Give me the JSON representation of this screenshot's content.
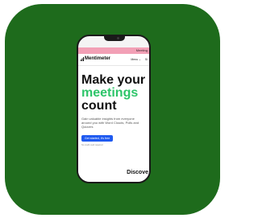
{
  "colors": {
    "tile_background": "#1e6b1c",
    "phone_frame": "#1a1a1a",
    "banner": "#f2a0b6",
    "headline_accent": "#2ec56a",
    "cta_button": "#1f5af0"
  },
  "banner": {
    "text": "Meeting"
  },
  "nav": {
    "logo": "Mentimeter",
    "link_1": "Menu ⌄",
    "link_2": "Si"
  },
  "hero": {
    "line_1": "Make your",
    "line_2": "meetings",
    "line_3": "count",
    "body": "Gain valuable insights from everyone around you with Word Clouds, Polls and Quizzes",
    "cta_label": "Get started, it's free",
    "fine_print": "No credit card required"
  },
  "footer": {
    "discover": "Discove"
  },
  "icons": {
    "logo": "bar-chart-icon"
  }
}
